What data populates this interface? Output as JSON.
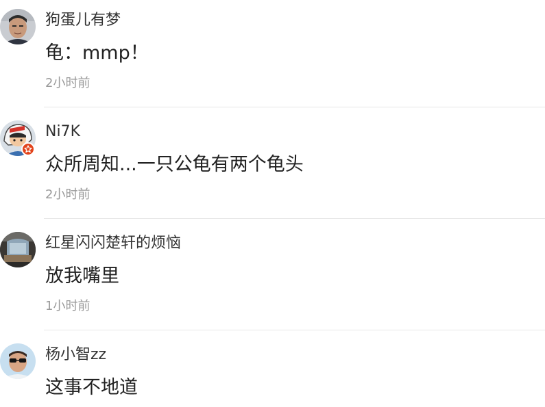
{
  "comments": [
    {
      "username": "狗蛋儿有梦",
      "content": "龟：mmp！",
      "time": "2小时前",
      "avatar_icon": "avatar-user-photo-icon"
    },
    {
      "username": "Ni7K",
      "content": "众所周知...一只公龟有两个龟头",
      "time": "2小时前",
      "avatar_icon": "avatar-cartoon-racer-icon",
      "badge_icon": "vip-star-badge-icon"
    },
    {
      "username": "红星闪闪楚轩的烦恼",
      "content": "放我嘴里",
      "time": "1小时前",
      "avatar_icon": "avatar-room-photo-icon"
    },
    {
      "username": "杨小智zz",
      "content": "这事不地道",
      "time": "",
      "avatar_icon": "avatar-sunglasses-photo-icon"
    }
  ],
  "colors": {
    "username": "#333333",
    "content": "#222222",
    "time": "#9a9a9a",
    "divider": "#e6e6e6",
    "badge": "#e2431b"
  }
}
